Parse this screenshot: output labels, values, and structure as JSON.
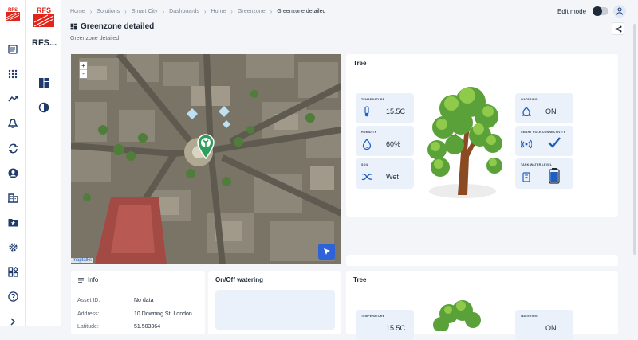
{
  "rail": {
    "logo_text": "RFS",
    "icons": [
      "assets-icon",
      "apps-icon",
      "trend-icon",
      "alarm-bell-icon",
      "sync-icon",
      "user-circle-icon",
      "building-icon",
      "star-folder-icon",
      "settings-icon",
      "widgets-icon",
      "help-icon",
      "expand-icon"
    ]
  },
  "sidebar": {
    "logo_text": "RFS",
    "title": "RFS...",
    "icons": [
      "dashboard-grid-icon",
      "contrast-icon"
    ]
  },
  "breadcrumbs": [
    "Home",
    "Solutions",
    "Smart City",
    "Dashboards",
    "Home",
    "Greenzone",
    "Greenzone detailed"
  ],
  "topbar": {
    "edit_mode_label": "Edit mode"
  },
  "page": {
    "title": "Greenzone detailed",
    "subtitle": "Greenzone detailed"
  },
  "map": {
    "zoom_in": "+",
    "zoom_out": "-",
    "attribution": "maptalks"
  },
  "tree_panel": {
    "title": "Tree",
    "left_tiles": [
      {
        "label": "TEMPERATURE",
        "value": "15.5C",
        "icon": "thermometer-icon"
      },
      {
        "label": "HUMIDITY",
        "value": "60%",
        "icon": "humidity-icon"
      },
      {
        "label": "SOIL",
        "value": "Wet",
        "icon": "soil-icon"
      }
    ],
    "right_tiles": [
      {
        "label": "WATERING",
        "value": "ON",
        "icon": "watering-icon"
      },
      {
        "label": "SMART POLE CONNECTIVITY",
        "value": "",
        "icon": "connectivity-icon"
      },
      {
        "label": "TANK WATER LEVEL",
        "value": "",
        "icon": "tank-icon"
      }
    ]
  },
  "info_panel": {
    "title": "Info",
    "rows": [
      {
        "key": "Asset ID:",
        "value": "No data"
      },
      {
        "key": "Address:",
        "value": "10 Downing St, London"
      },
      {
        "key": "Latitude:",
        "value": "51.503364"
      }
    ]
  },
  "watering_panel": {
    "title": "On/Off watering"
  },
  "tree_panel_2": {
    "title": "Tree",
    "left_tiles": [
      {
        "label": "TEMPERATURE",
        "value": "15.5C"
      }
    ],
    "right_tiles": [
      {
        "label": "WATERING",
        "value": "ON"
      }
    ]
  },
  "colors": {
    "accent": "#2e62d9",
    "tile_bg": "#eaf1fb",
    "icon_blue": "#1f5fbf",
    "marker_green": "#2f9e5a",
    "tank_blue": "#1f5fbf"
  }
}
